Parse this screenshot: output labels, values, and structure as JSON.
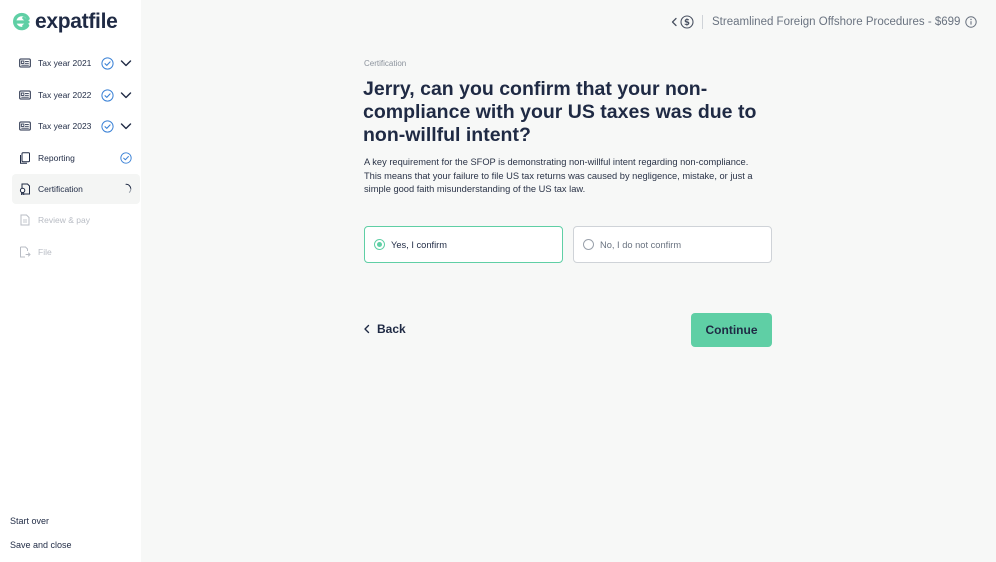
{
  "app": {
    "logo_text": "expatfile",
    "brand_color": "#5fcfa5"
  },
  "sidebar": {
    "items": [
      {
        "label": "Tax year 2021",
        "icon": "id-card-icon",
        "status": "complete",
        "expandable": true
      },
      {
        "label": "Tax year 2022",
        "icon": "id-card-icon",
        "status": "complete",
        "expandable": true
      },
      {
        "label": "Tax year 2023",
        "icon": "id-card-icon",
        "status": "complete",
        "expandable": true
      },
      {
        "label": "Reporting",
        "icon": "documents-icon",
        "status": "complete",
        "expandable": false
      },
      {
        "label": "Certification",
        "icon": "certificate-icon",
        "status": "in-progress",
        "expandable": false
      },
      {
        "label": "Review & pay",
        "icon": "document-icon",
        "status": "disabled",
        "expandable": false
      },
      {
        "label": "File",
        "icon": "file-send-icon",
        "status": "disabled",
        "expandable": false
      }
    ],
    "start_over": "Start over",
    "save_and_close": "Save and close"
  },
  "header": {
    "title": "Streamlined Foreign Offshore Procedures - $699"
  },
  "main": {
    "eyebrow": "Certification",
    "question": "Jerry, can you confirm that your non-compliance with your US taxes was due to non-willful intent?",
    "description": "A key requirement for the SFOP is demonstrating non-willful intent regarding non-compliance. This means that your failure to file US tax returns was caused by negligence, mistake, or just a simple good faith misunderstanding of the US tax law.",
    "options": [
      {
        "label": "Yes, I confirm",
        "selected": true
      },
      {
        "label": "No, I do not confirm",
        "selected": false
      }
    ],
    "back_label": "Back",
    "continue_label": "Continue"
  }
}
